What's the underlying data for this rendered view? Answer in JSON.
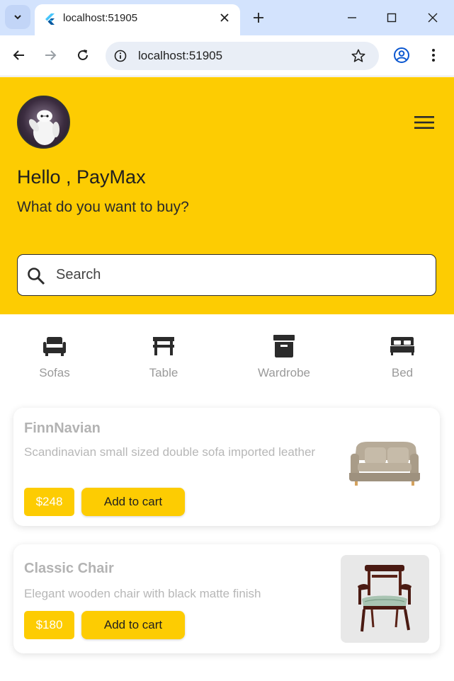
{
  "browser": {
    "tab_title": "localhost:51905",
    "url": "localhost:51905"
  },
  "header": {
    "greeting": "Hello , PayMax",
    "subtitle": "What do you want to buy?"
  },
  "search": {
    "placeholder": "Search"
  },
  "categories": [
    {
      "label": "Sofas",
      "icon": "sofa-icon"
    },
    {
      "label": "Table",
      "icon": "table-icon"
    },
    {
      "label": "Wardrobe",
      "icon": "wardrobe-icon"
    },
    {
      "label": "Bed",
      "icon": "bed-icon"
    }
  ],
  "products": [
    {
      "title": "FinnNavian",
      "description": "Scandinavian small sized double sofa imported leather",
      "price": "$248",
      "button": "Add to cart"
    },
    {
      "title": "Classic Chair",
      "description": "Elegant wooden chair with black matte finish",
      "price": "$180",
      "button": "Add to cart"
    }
  ],
  "colors": {
    "accent": "#fdcc02",
    "browser_frame": "#d3e3fd"
  }
}
